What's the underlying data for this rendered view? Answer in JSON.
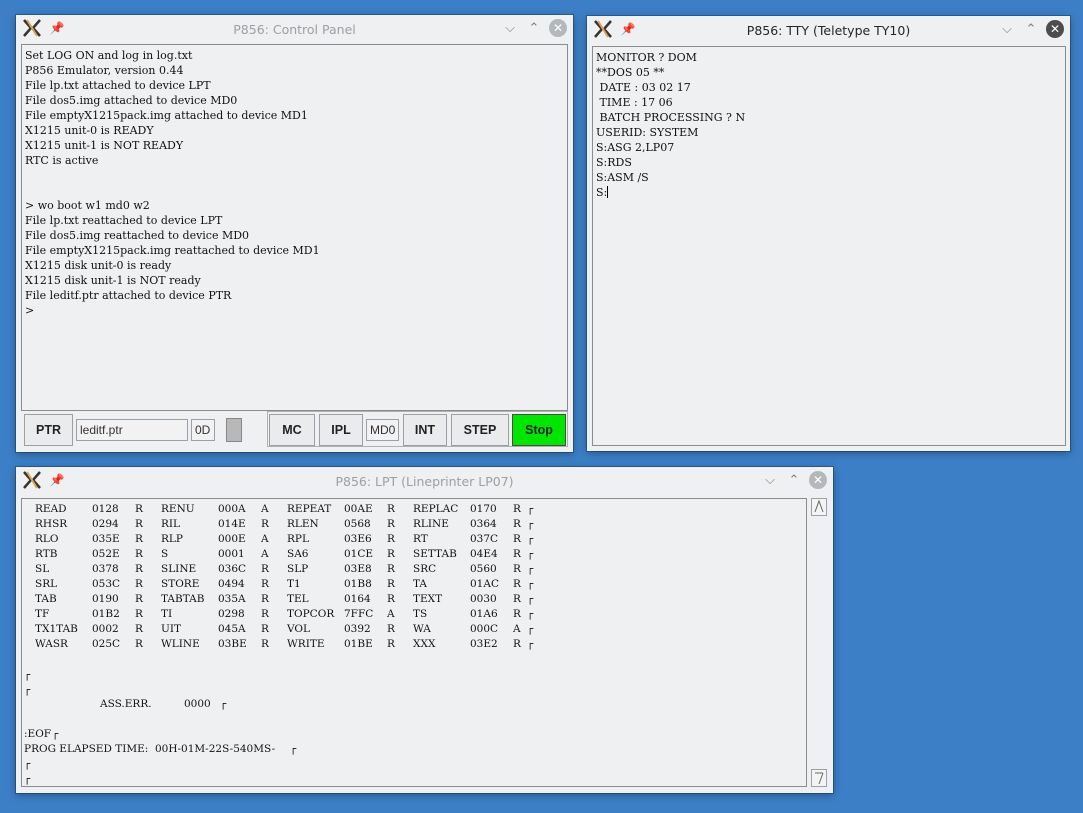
{
  "control_panel": {
    "title": "P856: Control Panel",
    "console_lines": [
      "Set LOG ON and log in log.txt",
      "P856 Emulator, version 0.44",
      "File lp.txt attached to device LPT",
      "File dos5.img attached to device MD0",
      "File emptyX1215pack.img attached to device MD1",
      "X1215 unit-0 is READY",
      "X1215 unit-1 is NOT READY",
      "RTC is active",
      "",
      "",
      "> wo boot w1 md0 w2",
      "File lp.txt reattached to device LPT",
      "File dos5.img reattached to device MD0",
      "File emptyX1215pack.img reattached to device MD1",
      "X1215 disk unit-0 is ready",
      "X1215 disk unit-1 is NOT ready",
      "File leditf.ptr attached to device PTR",
      ">"
    ],
    "ptr_button": "PTR",
    "ptr_file": "leditf.ptr",
    "ptr_code": "0D",
    "mc_button": "MC",
    "ipl_button": "IPL",
    "ipl_device": "MD0",
    "int_button": "INT",
    "step_button": "STEP",
    "stop_button": "Stop",
    "stop_color": "#00e600"
  },
  "tty": {
    "title": "P856: TTY (Teletype TY10)",
    "lines": [
      "MONITOR ? DOM",
      "**DOS 05 **",
      " DATE : 03 02 17",
      " TIME : 17 06",
      " BATCH PROCESSING ? N",
      "USERID: SYSTEM",
      "S:ASG 2,LP07",
      "S:RDS",
      "S:ASM /S",
      "S:"
    ]
  },
  "lpt": {
    "title": "P856: LPT (Lineprinter LP07)",
    "symbol_rows": [
      [
        [
          "READ",
          "0128",
          "R"
        ],
        [
          "RENU",
          "000A",
          "A"
        ],
        [
          "REPEAT",
          "00AE",
          "R"
        ],
        [
          "REPLAC",
          "0170",
          "R"
        ]
      ],
      [
        [
          "RHSR",
          "0294",
          "R"
        ],
        [
          "RIL",
          "014E",
          "R"
        ],
        [
          "RLEN",
          "0568",
          "R"
        ],
        [
          "RLINE",
          "0364",
          "R"
        ]
      ],
      [
        [
          "RLO",
          "035E",
          "R"
        ],
        [
          "RLP",
          "000E",
          "A"
        ],
        [
          "RPL",
          "03E6",
          "R"
        ],
        [
          "RT",
          "037C",
          "R"
        ]
      ],
      [
        [
          "RTB",
          "052E",
          "R"
        ],
        [
          "S",
          "0001",
          "A"
        ],
        [
          "SA6",
          "01CE",
          "R"
        ],
        [
          "SETTAB",
          "04E4",
          "R"
        ]
      ],
      [
        [
          "SL",
          "0378",
          "R"
        ],
        [
          "SLINE",
          "036C",
          "R"
        ],
        [
          "SLP",
          "03E8",
          "R"
        ],
        [
          "SRC",
          "0560",
          "R"
        ]
      ],
      [
        [
          "SRL",
          "053C",
          "R"
        ],
        [
          "STORE",
          "0494",
          "R"
        ],
        [
          "T1",
          "01B8",
          "R"
        ],
        [
          "TA",
          "01AC",
          "R"
        ]
      ],
      [
        [
          "TAB",
          "0190",
          "R"
        ],
        [
          "TABTAB",
          "035A",
          "R"
        ],
        [
          "TEL",
          "0164",
          "R"
        ],
        [
          "TEXT",
          "0030",
          "R"
        ]
      ],
      [
        [
          "TF",
          "01B2",
          "R"
        ],
        [
          "TI",
          "0298",
          "R"
        ],
        [
          "TOPCOR",
          "7FFC",
          "A"
        ],
        [
          "TS",
          "01A6",
          "R"
        ]
      ],
      [
        [
          "TX1TAB",
          "0002",
          "R"
        ],
        [
          "UIT",
          "045A",
          "R"
        ],
        [
          "VOL",
          "0392",
          "R"
        ],
        [
          "WA",
          "000C",
          "A"
        ]
      ],
      [
        [
          "WASR",
          "025C",
          "R"
        ],
        [
          "WLINE",
          "03BE",
          "R"
        ],
        [
          "WRITE",
          "01BE",
          "R"
        ],
        [
          "XXX",
          "03E2",
          "R"
        ]
      ]
    ],
    "line_mark": "┌",
    "ass_err_label": "ASS.ERR.",
    "ass_err_value": "0000",
    "eof_line": ":EOF",
    "elapsed_line": "PROG ELAPSED TIME:  00H-01M-22S-540MS-"
  }
}
